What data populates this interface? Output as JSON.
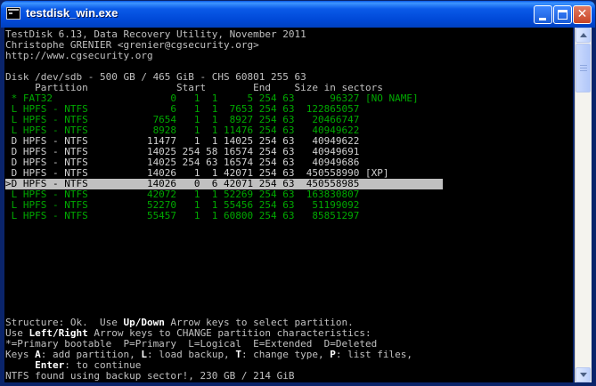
{
  "window": {
    "title": "testdisk_win.exe"
  },
  "header": {
    "line1": "TestDisk 6.13, Data Recovery Utility, November 2011",
    "line2": "Christophe GRENIER <grenier@cgsecurity.org>",
    "line3": "http://www.cgsecurity.org"
  },
  "disk": {
    "info": "Disk /dev/sdb - 500 GB / 465 GiB - CHS 60801 255 63",
    "columns_line": "     Partition               Start        End    Size in sectors"
  },
  "partitions": [
    {
      "text": " * FAT32                    0   1  1     5 254 63      96327 [NO NAME]",
      "color": "green",
      "selected": false
    },
    {
      "text": " L HPFS - NTFS              6   1  1  7653 254 63  122865057",
      "color": "green",
      "selected": false
    },
    {
      "text": " L HPFS - NTFS           7654   1  1  8927 254 63   20466747",
      "color": "green",
      "selected": false
    },
    {
      "text": " L HPFS - NTFS           8928   1  1 11476 254 63   40949622",
      "color": "green",
      "selected": false
    },
    {
      "text": " D HPFS - NTFS          11477   1  1 14025 254 63   40949622",
      "color": "white",
      "selected": false
    },
    {
      "text": " D HPFS - NTFS          14025 254 58 16574 254 63   40949691",
      "color": "white",
      "selected": false
    },
    {
      "text": " D HPFS - NTFS          14025 254 63 16574 254 63   40949686",
      "color": "white",
      "selected": false
    },
    {
      "text": " D HPFS - NTFS          14026   1  1 42071 254 63  450558990 [XP]",
      "color": "white",
      "selected": false
    },
    {
      "text": ">D HPFS - NTFS          14026   0  6 42071 254 63  450558985",
      "color": "white",
      "selected": true
    },
    {
      "text": " L HPFS - NTFS          42072   1  1 52269 254 63  163830807",
      "color": "green",
      "selected": false
    },
    {
      "text": " L HPFS - NTFS          52270   1  1 55456 254 63   51199092",
      "color": "green",
      "selected": false
    },
    {
      "text": " L HPFS - NTFS          55457   1  1 60800 254 63   85851297",
      "color": "green",
      "selected": false
    }
  ],
  "footer": {
    "structure_a": "Structure: Ok.  Use ",
    "structure_b": "Up/Down",
    "structure_c": " Arrow keys to select partition.",
    "use_a": "Use ",
    "use_b": "Left/Right",
    "use_c": " Arrow keys to CHANGE partition characteristics:",
    "legend": "*=Primary bootable  P=Primary  L=Logical  E=Extended  D=Deleted",
    "keys_a": "Keys ",
    "keys_b": "A",
    "keys_c": ": add partition, ",
    "keys_d": "L",
    "keys_e": ": load backup, ",
    "keys_f": "T",
    "keys_g": ": change type, ",
    "keys_h": "P",
    "keys_i": ": list files,",
    "enter_a": "     ",
    "enter_b": "Enter",
    "enter_c": ": to continue",
    "status": "NTFS found using backup sector!, 230 GB / 214 GiB"
  },
  "colors": {
    "console_bg": "#000000",
    "console_text": "#c0c0c0",
    "green_text": "#00a800",
    "highlight_bg": "#c0c0c0",
    "titlebar": "#0a5ae8"
  },
  "icons": {
    "app": "console-icon",
    "minimize": "minimize-icon",
    "maximize": "maximize-icon",
    "close": "close-icon"
  }
}
